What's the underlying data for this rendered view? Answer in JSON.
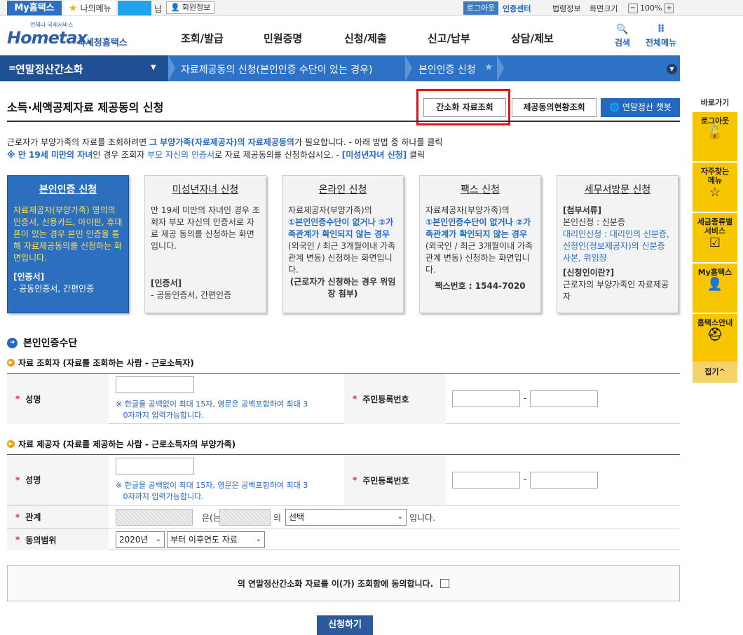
{
  "util": {
    "my_hometax": "My홈택스",
    "my_menu": "나의메뉴",
    "nim": "님",
    "member_info": "회원정보",
    "logout": "로그아웃",
    "cert_center": "인증센터",
    "law_info": "법령정보",
    "screen_size": "화면크기",
    "zoom": "100%",
    "minus": "−",
    "plus": "+"
  },
  "header": {
    "logo_main": "Hometax.",
    "logo_sub": "언제나 국세서비스",
    "logo_kr": "국세청홈택스",
    "nav": [
      "조회/발급",
      "민원증명",
      "신청/제출",
      "신고/납부",
      "상담/제보"
    ],
    "search": "검색",
    "all_menu": "전체메뉴"
  },
  "navbar": {
    "menu": "연말정산간소화",
    "crumb1": "자료제공동의 신청(본인인증 수단이 있는 경우)",
    "crumb2": "본인인증 신청"
  },
  "page": {
    "title": "소득·세액공제자료 제공동의 신청",
    "btn_simple": "간소화 자료조회",
    "btn_status": "제공동의현황조회",
    "btn_chatbot": "연말정산 챗봇"
  },
  "intro": {
    "l1a": "근로자가 부양가족의 자료를 조회하려면 ",
    "l1b": "그 부양가족(자료제공자)의 자료제공동의",
    "l1c": "가 필요합니다. - 아래 방법 중 하나를 클릭",
    "l2a": "※ 만 19세 미만의 자녀",
    "l2b": "인 경우 조회자 ",
    "l2c": "부모 자신의 인증서",
    "l2d": "로 자료 제공동의를 신청하십시오. - ",
    "l2e": "[미성년자녀 신청]",
    "l2f": " 클릭"
  },
  "cards": [
    {
      "title": "본인인증 신청",
      "body": "자료제공자(부양가족) 명의의 인증서, 신용카드, 아이핀, 휴대폰이 있는 경우 본인 인증을 통해 자료제공동의를 신청하는 화면입니다.",
      "bh": "[인증서]",
      "b2": "- 공동인증서, 간편인증"
    },
    {
      "title": "미성년자녀 신청",
      "body": "만 19세 미만의 자녀인 경우 조회자 부모 자신의 인증서로 자료 제공 동의를 신청하는 화면입니다.",
      "bh": "[인증서]",
      "b2": "- 공동인증서, 간편인증"
    },
    {
      "title": "온라인 신청",
      "body1": "자료제공자(부양가족)의",
      "body2": "①본인인증수단이 없거나 ②가족관계가 확인되지 않는 경우",
      "body3": "(외국인 / 최근 3개월이내 가족관계 변동) 신청하는 화면입니다.",
      "b2": "(근로자가 신청하는 경우 위임장 첨부)"
    },
    {
      "title": "팩스 신청",
      "body1": "자료제공자(부양가족)의",
      "body2": "①본인인증수단이 없거나 ②가족관계가 확인되지 않는 경우",
      "body3": "(외국인 / 최근 3개월이내 가족관계 변동) 신청하는 화면입니다.",
      "b2": "팩스번호 : 1544-7020"
    },
    {
      "title": "세무서방문 신청",
      "bh": "[첨부서류]",
      "body1": "본인신청 : 신분증",
      "body2": "대리인신청 : 대리인의 신분증, 신청인(정보제공자)의 신분증 사본, 위임장",
      "bh2": "[신청인이란?]",
      "b2": "근로자의 부양가족인 자료제공자"
    }
  ],
  "form": {
    "section": "본인인증수단",
    "sub1": "자료 조회자 (자료를 조회하는 사람 - 근로소득자)",
    "sub2": "자료 제공자 (자료를 제공하는 사람 - 근로소득자의 부양가족)",
    "name": "성명",
    "rrn": "주민등록번호",
    "hint1": "※ 한글을 공백없이 최대 15자, 영문은 공백포함하여 최대 3",
    "hint2": "0자까지 입력가능합니다.",
    "dash": "-",
    "relation": "관계",
    "eun": "은(는)",
    "ui": "의",
    "select": "선택",
    "imnida": "입니다.",
    "scope": "동의범위",
    "year": "2020년",
    "scope_opt": "부터 이후연도 자료"
  },
  "agree": {
    "text": "의 연말정산간소화 자료를 이(가) 조회함에 동의합니다."
  },
  "apply": "신청하기",
  "quick": {
    "title": "바로가기",
    "items": [
      "로그아웃",
      "자주찾는\n메뉴",
      "세금종류별\n서비스",
      "My홈택스",
      "홈택스안내"
    ],
    "close": "접기^"
  }
}
